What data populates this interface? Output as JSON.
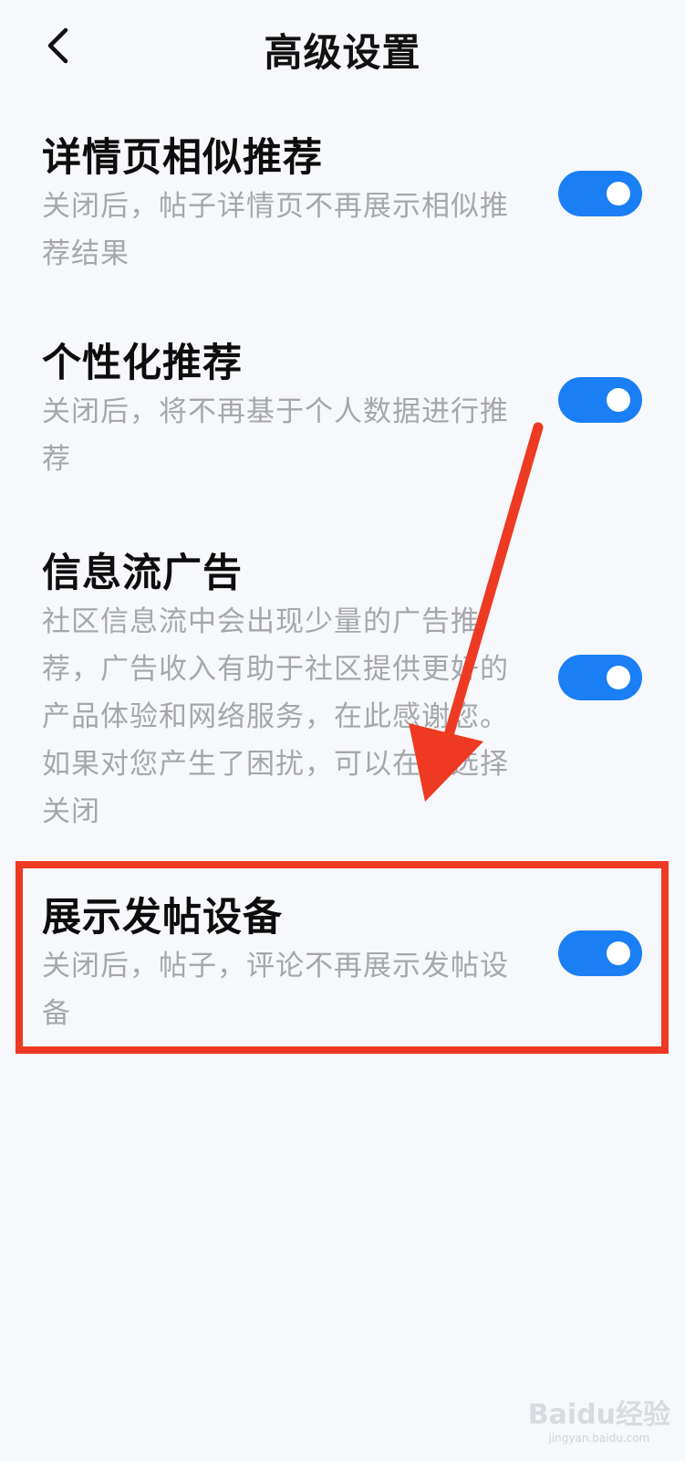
{
  "header": {
    "title": "高级设置",
    "back_icon": "chevron-left-icon"
  },
  "settings": [
    {
      "title": "详情页相似推荐",
      "desc": "关闭后，帖子详情页不再展示相似推荐结果",
      "enabled": true
    },
    {
      "title": "个性化推荐",
      "desc": "关闭后，将不再基于个人数据进行推荐",
      "enabled": true
    },
    {
      "title": "信息流广告",
      "desc": "社区信息流中会出现少量的广告推荐，广告收入有助于社区提供更好的产品体验和网络服务，在此感谢您。如果对您产生了困扰，可以在此选择关闭",
      "enabled": true
    },
    {
      "title": "展示发帖设备",
      "desc": "关闭后，帖子，评论不再展示发帖设备",
      "enabled": true
    }
  ],
  "colors": {
    "toggle_on": "#1a7ef5",
    "annotation": "#ee3a22"
  },
  "watermark": {
    "text": "Baidu经验",
    "sub": "jingyan.baidu.com"
  }
}
